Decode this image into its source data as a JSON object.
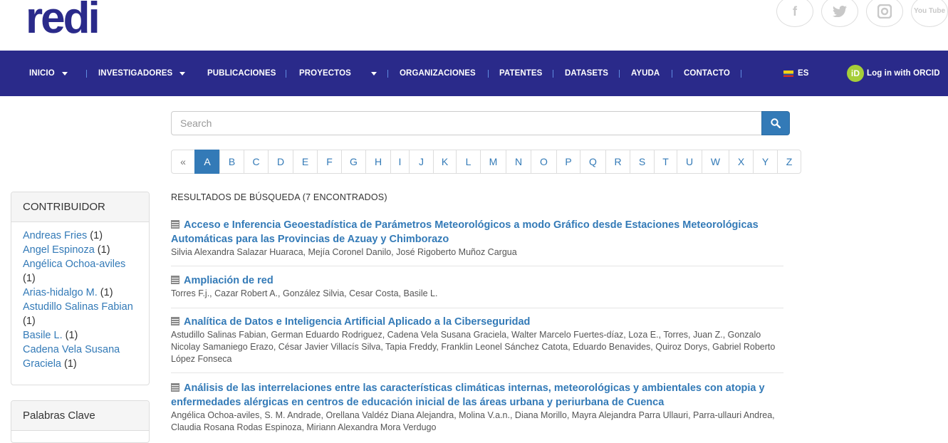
{
  "brand": {
    "logo_text": "redi"
  },
  "social": [
    {
      "name": "facebook-icon",
      "glyph": "f"
    },
    {
      "name": "twitter-icon",
      "glyph": "t"
    },
    {
      "name": "instagram-icon",
      "glyph": "◻"
    },
    {
      "name": "youtube-icon",
      "glyph": "You Tube"
    }
  ],
  "nav": {
    "inicio": "INICIO",
    "investigadores": "INVESTIGADORES",
    "publicaciones": "PUBLICACIONES",
    "proyectos": "PROYECTOS",
    "organizaciones": "ORGANIZACIONES",
    "patentes": "PATENTES",
    "datasets": "DATASETS",
    "ayuda": "AYUDA",
    "contacto": "CONTACTO",
    "language": "ES",
    "orcid_login": "Log in with ORCID",
    "orcid_icon_text": "iD"
  },
  "search": {
    "placeholder": "Search"
  },
  "alphabet": {
    "prev": "«",
    "letters": [
      "A",
      "B",
      "C",
      "D",
      "E",
      "F",
      "G",
      "H",
      "I",
      "J",
      "K",
      "L",
      "M",
      "N",
      "O",
      "P",
      "Q",
      "R",
      "S",
      "T",
      "U",
      "W",
      "X",
      "Y",
      "Z"
    ],
    "active": "A"
  },
  "sidebar": {
    "contribuidor": {
      "heading": "CONTRIBUIDOR",
      "items": [
        {
          "name": "Andreas Fries",
          "count": "(1)"
        },
        {
          "name": "Angel Espinoza",
          "count": "(1)"
        },
        {
          "name": "Angélica Ochoa-aviles",
          "count": "(1)"
        },
        {
          "name": "Arias-hidalgo M.",
          "count": "(1)"
        },
        {
          "name": "Astudillo Salinas Fabian",
          "count": "(1)"
        },
        {
          "name": "Basile L.",
          "count": "(1)"
        },
        {
          "name": "Cadena Vela Susana Graciela",
          "count": "(1)"
        }
      ]
    },
    "palabras_clave": {
      "heading": "Palabras Clave"
    }
  },
  "results": {
    "heading": "RESULTADOS DE BÚSQUEDA (7 ENCONTRADOS)",
    "items": [
      {
        "title": "Acceso e Inferencia Geoestadística de Parámetros Meteorológicos a modo Gráfico desde Estaciones Meteorológicas Automáticas para las Provincias de Azuay y Chimborazo",
        "authors": "Silvia Alexandra Salazar Huaraca,   Mejía Coronel Danilo,   José Rigoberto Muñoz Cargua"
      },
      {
        "title": "Ampliación de red",
        "authors": "Torres F.j.,   Cazar Robert A.,   González Silvia,   Cesar Costa,   Basile L."
      },
      {
        "title": "Analítica de Datos e Inteligencia Artificial Aplicado a la Ciberseguridad",
        "authors": "Astudillo Salinas Fabian,   German Eduardo Rodriguez,   Cadena Vela Susana Graciela,   Walter Marcelo Fuertes-díaz,   Loza E.,   Torres,   Juan Z.,   Gonzalo Nicolay Samaniego Erazo,   César Javier Villacís Silva,   Tapia Freddy,   Franklin Leonel Sánchez Catota,   Eduardo Benavides,   Quiroz Dorys,   Gabriel Roberto López Fonseca"
      },
      {
        "title": "Análisis de las interrelaciones entre las características climáticas internas, meteorológicas y ambientales con atopia y enfermedades alérgicas en centros de educación inicial de las áreas urbana y periurbana de Cuenca",
        "authors": "Angélica Ochoa-aviles,   S. M. Andrade,   Orellana Valdéz Diana Alejandra,   Molina V.a.n.,   Diana Morillo,   Mayra Alejandra Parra Ullauri,   Parra-ullauri Andrea,   Claudia Rosana Rodas Espinoza,   Miriann Alexandra Mora Verdugo"
      }
    ]
  },
  "colors": {
    "navbar": "#2a2a8a",
    "link": "#337ab7",
    "orcid": "#a6ce39"
  }
}
